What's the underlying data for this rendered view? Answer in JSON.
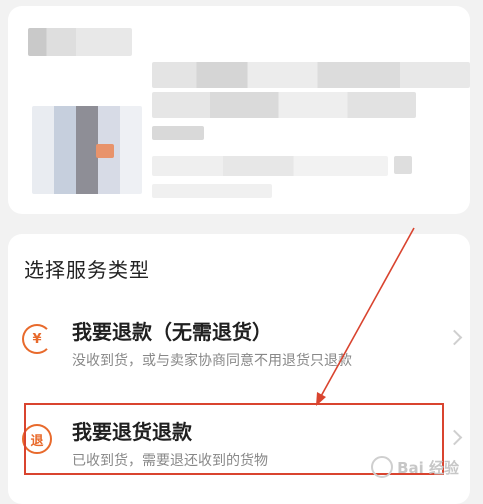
{
  "service_section": {
    "title": "选择服务类型",
    "items": [
      {
        "id": "refund-only",
        "icon": "yuan-refund-icon",
        "icon_glyph": "¥",
        "title": "我要退款（无需退货）",
        "description": "没收到货，或与卖家协商同意不用退货只退款"
      },
      {
        "id": "return-refund",
        "icon": "return-icon",
        "icon_glyph": "退",
        "title": "我要退货退款",
        "description": "已收到货，需要退还收到的货物"
      }
    ]
  },
  "colors": {
    "accent": "#e86a2c",
    "highlight_border": "#d9442f",
    "annotation_arrow": "#d9442f"
  },
  "watermark": {
    "text": "Bai 经验"
  }
}
